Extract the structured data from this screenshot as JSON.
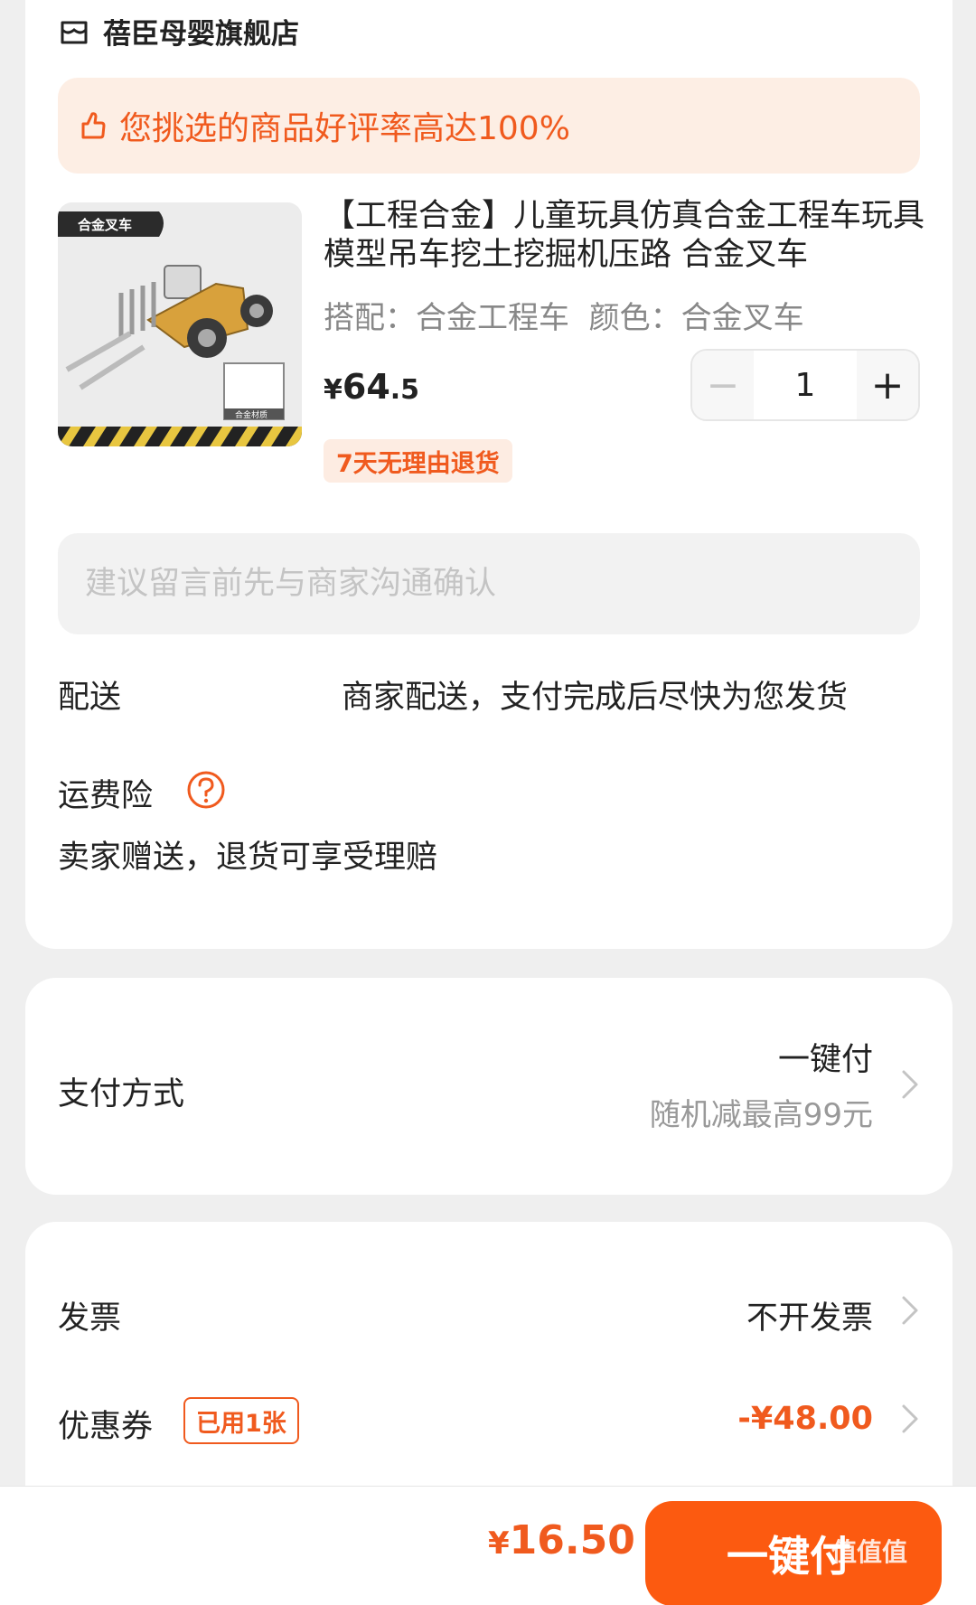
{
  "store": {
    "name": "蓓臣母婴旗舰店",
    "icon": "store-icon"
  },
  "rating_banner": {
    "text": "您挑选的商品好评率高达100%",
    "icon": "thumbs-up-icon"
  },
  "product": {
    "image_tag": "合金叉车",
    "image_thumb_caption": "合金材质",
    "title": "【工程合金】儿童玩具仿真合金工程车玩具模型吊车挖土挖掘机压路 合金叉车",
    "spec": "搭配：合金工程车  颜色：合金叉车",
    "price_symbol": "¥",
    "price_integer": "64",
    "price_decimal": ".5",
    "quantity": "1",
    "minus_label": "−",
    "plus_label": "+",
    "return_badge": "7天无理由退货"
  },
  "message": {
    "placeholder": "建议留言前先与商家沟通确认"
  },
  "delivery": {
    "label": "配送",
    "value": "商家配送，支付完成后尽快为您发货"
  },
  "insurance": {
    "label": "运费险",
    "description": "卖家赠送，退货可享受理赔",
    "icon": "help-circle-icon"
  },
  "payment": {
    "label": "支付方式",
    "method": "一键付",
    "promo": "随机减最高99元"
  },
  "invoice": {
    "label": "发票",
    "value": "不开发票"
  },
  "coupon": {
    "label": "优惠券",
    "tag": "已用1张",
    "value": "-¥48.00"
  },
  "footer": {
    "total_symbol": "¥",
    "total_amount": "16.50",
    "pay_button": "一键付",
    "watermark": "值值值"
  },
  "colors": {
    "accent": "#f05a1e",
    "button": "#fc5a10",
    "banner_bg": "#fdeee4"
  }
}
